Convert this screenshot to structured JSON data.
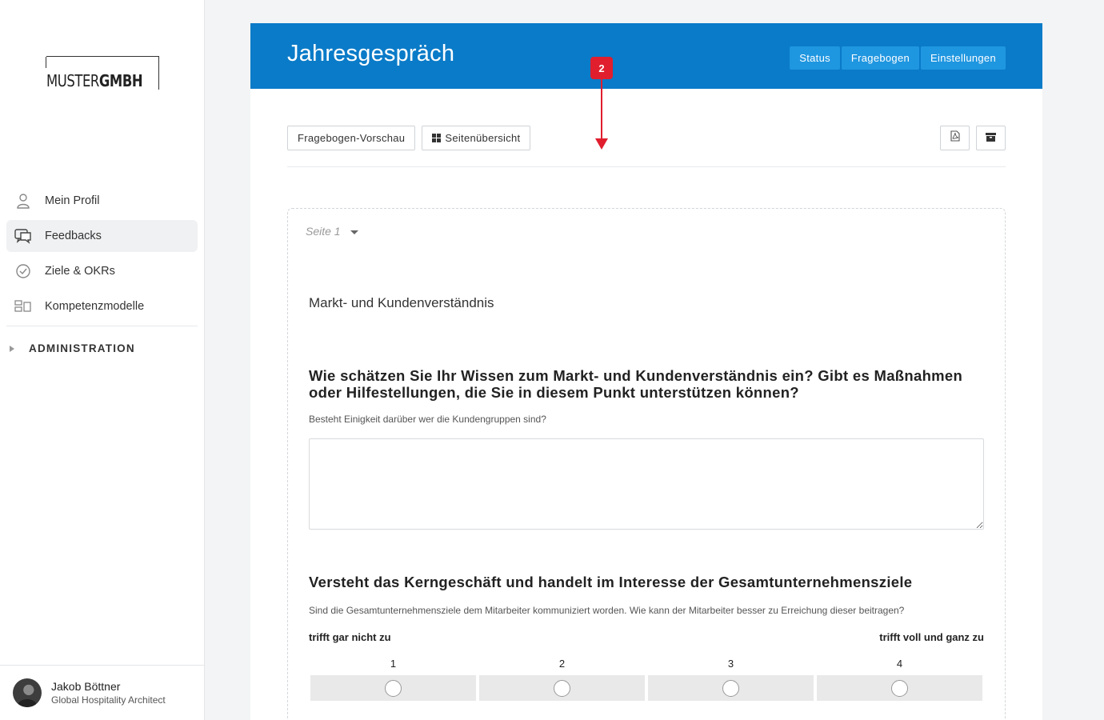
{
  "logo": {
    "part1": "MUSTER",
    "part2": "GMBH"
  },
  "nav": {
    "items": [
      {
        "label": "Mein Profil",
        "icon": "user-icon"
      },
      {
        "label": "Feedbacks",
        "icon": "chat-icon",
        "active": true
      },
      {
        "label": "Ziele & OKRs",
        "icon": "check-circle-icon"
      },
      {
        "label": "Kompetenzmodelle",
        "icon": "modules-icon"
      }
    ],
    "admin_label": "ADMINISTRATION"
  },
  "user": {
    "name": "Jakob Böttner",
    "role": "Global Hospitality Architect"
  },
  "header": {
    "title": "Jahresgespräch",
    "tabs": [
      "Status",
      "Fragebogen",
      "Einstellungen"
    ]
  },
  "toolbar": {
    "preview_label": "Fragebogen-Vorschau",
    "overview_label": "Seitenübersicht",
    "pdf_icon": "pdf-file-icon",
    "archive_icon": "archive-icon"
  },
  "annotation": {
    "number": "2",
    "color": "#e01e2e"
  },
  "page": {
    "label": "Seite 1",
    "section_title": "Markt- und Kundenverständnis",
    "question1": {
      "title": "Wie schätzen Sie Ihr Wissen zum Markt- und Kundenverständnis ein? Gibt es Maßnahmen oder Hilfestellungen, die Sie in diesem Punkt unterstützen können?",
      "description": "Besteht Einigkeit darüber wer die Kundengruppen sind?",
      "answer": ""
    },
    "question2": {
      "title": "Versteht das Kerngeschäft und handelt im Interesse der Gesamtunternehmensziele",
      "description": "Sind die Gesamtunternehmensziele dem Mitarbeiter kommuniziert worden. Wie kann der Mitarbeiter besser zu Erreichung dieser beitragen?",
      "scale_min_label": "trifft gar nicht zu",
      "scale_max_label": "trifft voll und ganz zu",
      "options": [
        "1",
        "2",
        "3",
        "4"
      ]
    }
  },
  "colors": {
    "header": "#0a7bc8",
    "tab": "#1f96e0"
  }
}
